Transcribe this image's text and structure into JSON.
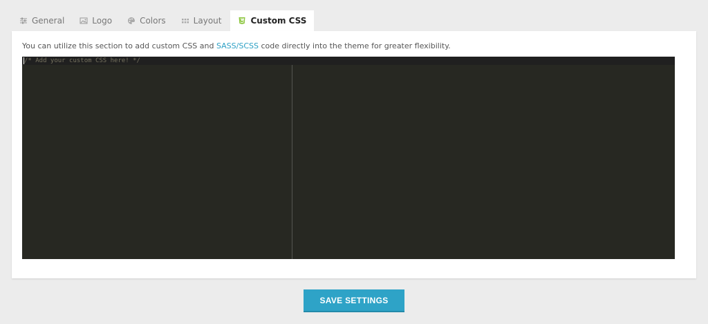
{
  "tabs": [
    {
      "label": "General",
      "icon": "sliders-icon",
      "active": false
    },
    {
      "label": "Logo",
      "icon": "image-icon",
      "active": false
    },
    {
      "label": "Colors",
      "icon": "palette-icon",
      "active": false
    },
    {
      "label": "Layout",
      "icon": "grid-icon",
      "active": false
    },
    {
      "label": "Custom CSS",
      "icon": "css3-icon",
      "active": true
    }
  ],
  "panel": {
    "description_before": "You can utilize this section to add custom CSS and ",
    "description_link": "SASS/SCSS",
    "description_after": " code directly into the theme for greater flexibility."
  },
  "editor": {
    "placeholder_code": "/* Add your custom CSS here! */"
  },
  "save_button": {
    "label": "SAVE SETTINGS"
  },
  "colors": {
    "accent": "#2ea3c7",
    "link": "#2a9fc4",
    "editor_bg": "#272822",
    "css3_icon": "#8dc63f"
  }
}
